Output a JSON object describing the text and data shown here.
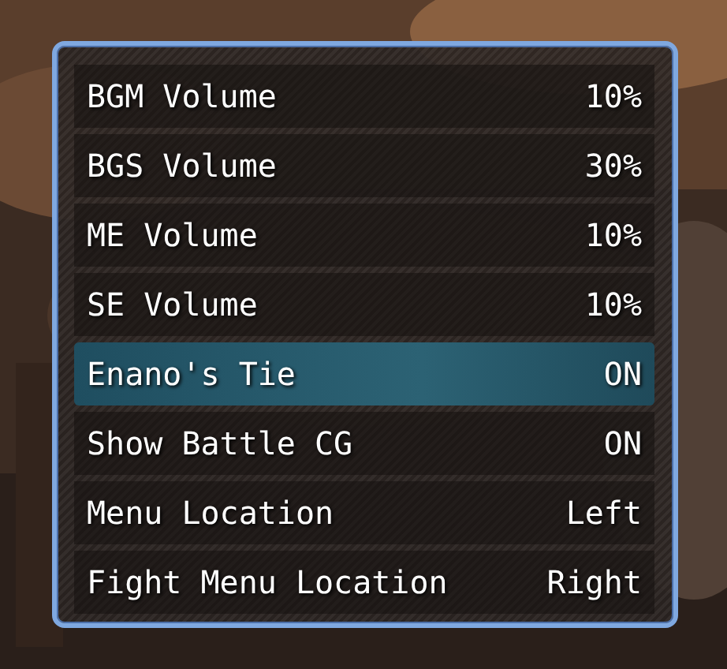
{
  "options": [
    {
      "label": "BGM Volume",
      "value": "10%",
      "selected": false
    },
    {
      "label": "BGS Volume",
      "value": "30%",
      "selected": false
    },
    {
      "label": "ME Volume",
      "value": "10%",
      "selected": false
    },
    {
      "label": "SE Volume",
      "value": "10%",
      "selected": false
    },
    {
      "label": "Enano's Tie",
      "value": "ON",
      "selected": true
    },
    {
      "label": "Show Battle CG",
      "value": "ON",
      "selected": false
    },
    {
      "label": "Menu Location",
      "value": "Left",
      "selected": false
    },
    {
      "label": "Fight Menu Location",
      "value": "Right",
      "selected": false
    }
  ]
}
